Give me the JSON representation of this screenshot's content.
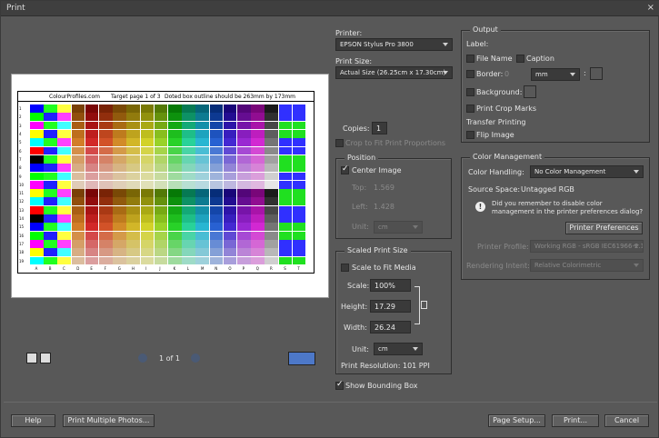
{
  "title": "Print",
  "close_glyph": "×",
  "preview": {
    "header_left": "ColourProfiles.com",
    "header_mid": "Target page 1 of 3",
    "header_right": "Doted box outline should be 263mm by 173mm",
    "page_label": "1 of 1",
    "column_letters": [
      "A",
      "B",
      "C",
      "D",
      "E",
      "F",
      "G",
      "H",
      "I",
      "J",
      "K",
      "L",
      "M",
      "N",
      "O",
      "P",
      "Q",
      "R",
      "S",
      "T"
    ],
    "row_numbers": [
      "1",
      "2",
      "3",
      "4",
      "5",
      "6",
      "7",
      "8",
      "9",
      "10",
      "11",
      "12",
      "13",
      "14",
      "15",
      "16",
      "17",
      "18",
      "19"
    ]
  },
  "printer": {
    "label": "Printer:",
    "value": "EPSON Stylus Pro 3800"
  },
  "print_size": {
    "label": "Print Size:",
    "value": "Actual Size (26.25cm x 17.30cm)"
  },
  "copies": {
    "label": "Copies:",
    "value": "1"
  },
  "crop_to_fit": {
    "label": "Crop to Fit Print Proportions",
    "checked": false
  },
  "position": {
    "title": "Position",
    "center_image": {
      "label": "Center Image",
      "checked": true
    },
    "top_label": "Top:",
    "top_value": "1.569",
    "left_label": "Left:",
    "left_value": "1.428",
    "unit_label": "Unit:",
    "unit_value": "cm"
  },
  "scaled": {
    "title": "Scaled Print Size",
    "scale_to_fit": {
      "label": "Scale to Fit Media",
      "checked": false
    },
    "scale_label": "Scale:",
    "scale_value": "100%",
    "height_label": "Height:",
    "height_value": "17.29",
    "width_label": "Width:",
    "width_value": "26.24",
    "unit_label": "Unit:",
    "unit_value": "cm",
    "resolution": "Print Resolution: 101 PPI"
  },
  "show_bounding_box": {
    "label": "Show Bounding Box",
    "checked": true
  },
  "output": {
    "title": "Output",
    "label_heading": "Label:",
    "file_name": "File Name",
    "caption": "Caption",
    "border_label": "Border:",
    "border_value": "0",
    "border_unit": "mm",
    "background": "Background:",
    "crop_marks": "Print Crop Marks",
    "transfer_heading": "Transfer Printing",
    "flip_image": "Flip Image"
  },
  "color": {
    "title": "Color Management",
    "handling_label": "Color Handling:",
    "handling_value": "No Color Management",
    "source_label": "Source Space:",
    "source_value": "Untagged RGB",
    "note": "Did you remember to disable color management in the printer preferences dialog?",
    "printer_prefs": "Printer Preferences",
    "profile_label": "Printer Profile:",
    "profile_value": "Working RGB - sRGB IEC61966-2.1",
    "intent_label": "Rendering Intent:",
    "intent_value": "Relative Colorimetric"
  },
  "buttons": {
    "help": "Help",
    "print_multiple": "Print Multiple Photos...",
    "page_setup": "Page Setup...",
    "print": "Print...",
    "cancel": "Cancel"
  }
}
